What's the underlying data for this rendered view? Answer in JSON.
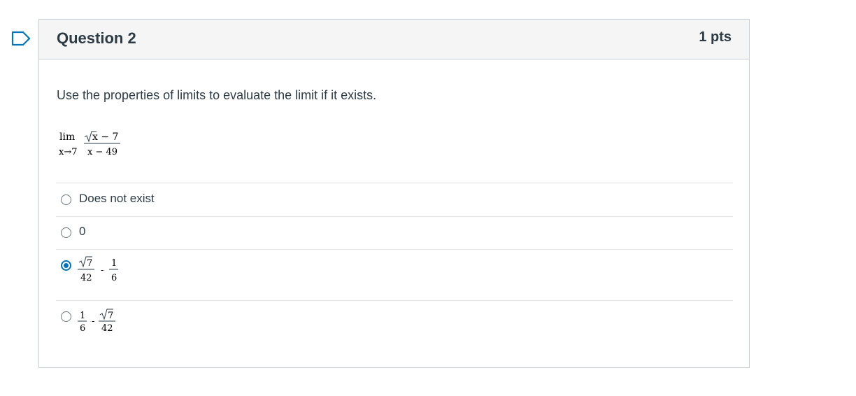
{
  "question": {
    "title": "Question 2",
    "points": "1 pts",
    "prompt": "Use the properties of limits to evaluate the limit if it exists.",
    "limit": {
      "lim": "lim",
      "approach": "x→7",
      "numerator_rest": "x − 7",
      "denominator": "x − 49"
    }
  },
  "answers": [
    {
      "label": "Does not exist",
      "selected": false
    },
    {
      "label": "0",
      "selected": false
    },
    {
      "expr": {
        "first_num_radicand": "7",
        "first_den": "42",
        "op": "-",
        "second_num": "1",
        "second_den": "6"
      },
      "selected": true
    },
    {
      "expr": {
        "first_num": "1",
        "first_den": "6",
        "op": "-",
        "second_num_radicand": "7",
        "second_den": "42"
      },
      "selected": false
    }
  ],
  "colors": {
    "accent": "#0374b5",
    "text": "#2d3b45",
    "border": "#c7cdd1",
    "header_bg": "#f5f5f5"
  }
}
